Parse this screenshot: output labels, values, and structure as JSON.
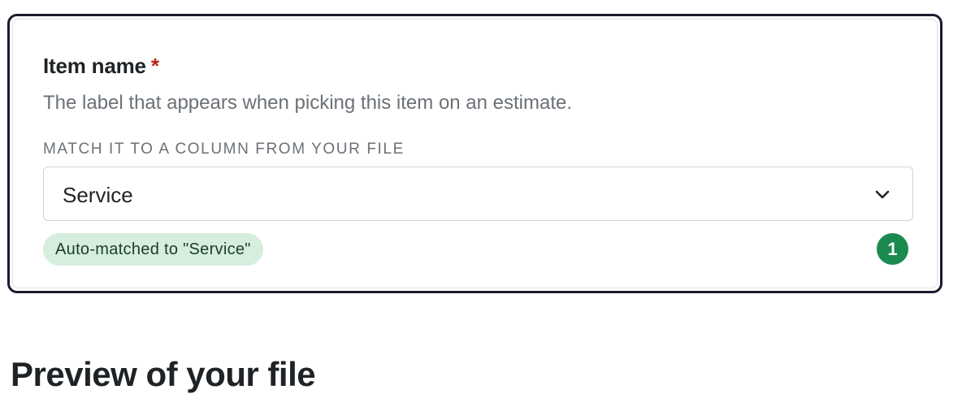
{
  "field": {
    "label": "Item name",
    "required_marker": "*",
    "description": "The label that appears when picking this item on an estimate.",
    "match_caption": "MATCH IT TO A COLUMN FROM YOUR FILE",
    "selected_column": "Service",
    "chevron_icon": "chevron-down-icon",
    "auto_match_badge": "Auto-matched to \"Service\"",
    "count": "1",
    "count_color": "#1a8a4f",
    "badge_color": "#d6eedd",
    "required_color": "#b3261e"
  },
  "preview": {
    "heading": "Preview of your file"
  }
}
